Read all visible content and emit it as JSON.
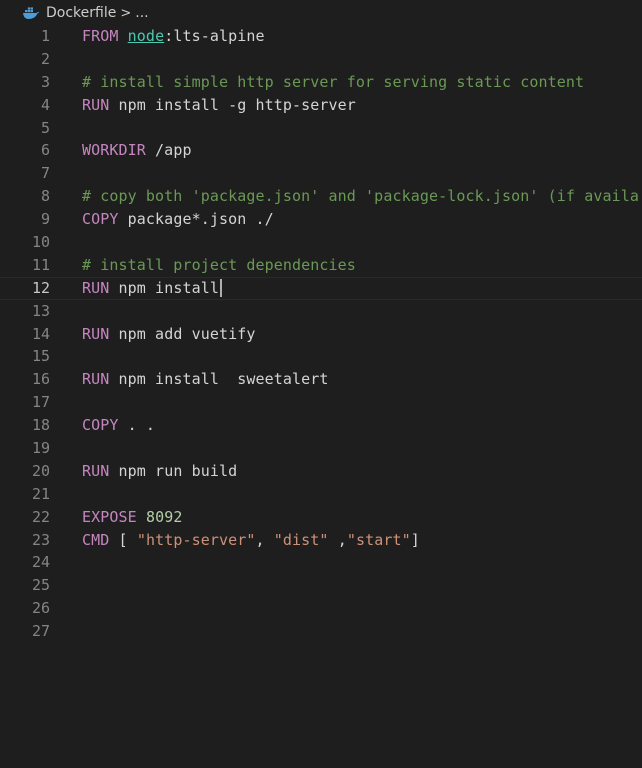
{
  "breadcrumb": {
    "file_icon": "docker-whale-icon",
    "file_name": "Dockerfile",
    "separator": ">",
    "ellipsis": "..."
  },
  "editor": {
    "current_line": 12,
    "lines": [
      {
        "num": "1",
        "tokens": [
          {
            "t": "FROM",
            "c": "kw"
          },
          {
            "t": " "
          },
          {
            "t": "node",
            "c": "img"
          },
          {
            "t": ":lts-alpine"
          }
        ]
      },
      {
        "num": "2",
        "tokens": []
      },
      {
        "num": "3",
        "tokens": [
          {
            "t": "# install simple http server for serving static content",
            "c": "cm"
          }
        ]
      },
      {
        "num": "4",
        "tokens": [
          {
            "t": "RUN",
            "c": "kw"
          },
          {
            "t": " npm install -g http-server"
          }
        ]
      },
      {
        "num": "5",
        "tokens": []
      },
      {
        "num": "6",
        "tokens": [
          {
            "t": "WORKDIR",
            "c": "kw"
          },
          {
            "t": " /app"
          }
        ]
      },
      {
        "num": "7",
        "tokens": []
      },
      {
        "num": "8",
        "tokens": [
          {
            "t": "# copy both 'package.json' and 'package-lock.json' (if availa",
            "c": "cm"
          }
        ]
      },
      {
        "num": "9",
        "tokens": [
          {
            "t": "COPY",
            "c": "kw"
          },
          {
            "t": " package*.json ./"
          }
        ]
      },
      {
        "num": "10",
        "tokens": []
      },
      {
        "num": "11",
        "tokens": [
          {
            "t": "# install project dependencies",
            "c": "cm"
          }
        ]
      },
      {
        "num": "12",
        "tokens": [
          {
            "t": "RUN",
            "c": "kw"
          },
          {
            "t": " npm install"
          }
        ],
        "cursor": true
      },
      {
        "num": "13",
        "tokens": []
      },
      {
        "num": "14",
        "tokens": [
          {
            "t": "RUN",
            "c": "kw"
          },
          {
            "t": " npm add vuetify"
          }
        ]
      },
      {
        "num": "15",
        "tokens": []
      },
      {
        "num": "16",
        "tokens": [
          {
            "t": "RUN",
            "c": "kw"
          },
          {
            "t": " npm install  sweetalert"
          }
        ]
      },
      {
        "num": "17",
        "tokens": []
      },
      {
        "num": "18",
        "tokens": [
          {
            "t": "COPY",
            "c": "kw"
          },
          {
            "t": " . ."
          }
        ]
      },
      {
        "num": "19",
        "tokens": []
      },
      {
        "num": "20",
        "tokens": [
          {
            "t": "RUN",
            "c": "kw"
          },
          {
            "t": " npm run build"
          }
        ]
      },
      {
        "num": "21",
        "tokens": []
      },
      {
        "num": "22",
        "tokens": [
          {
            "t": "EXPOSE",
            "c": "kw"
          },
          {
            "t": " "
          },
          {
            "t": "8092",
            "c": "nm"
          }
        ]
      },
      {
        "num": "23",
        "tokens": [
          {
            "t": "CMD",
            "c": "kw"
          },
          {
            "t": " [ "
          },
          {
            "t": "\"http-server\"",
            "c": "st"
          },
          {
            "t": ", "
          },
          {
            "t": "\"dist\"",
            "c": "st"
          },
          {
            "t": " ,"
          },
          {
            "t": "\"start\"",
            "c": "st"
          },
          {
            "t": "]"
          }
        ]
      },
      {
        "num": "24",
        "tokens": []
      },
      {
        "num": "25",
        "tokens": []
      },
      {
        "num": "26",
        "tokens": []
      },
      {
        "num": "27",
        "tokens": []
      }
    ]
  },
  "colors": {
    "background": "#1e1e1e",
    "keyword": "#c586c0",
    "comment": "#6a9955",
    "string": "#ce9178",
    "number": "#b5cea8",
    "image_name": "#4ec9b0",
    "default_text": "#d4d4d4",
    "line_number": "#858585"
  }
}
